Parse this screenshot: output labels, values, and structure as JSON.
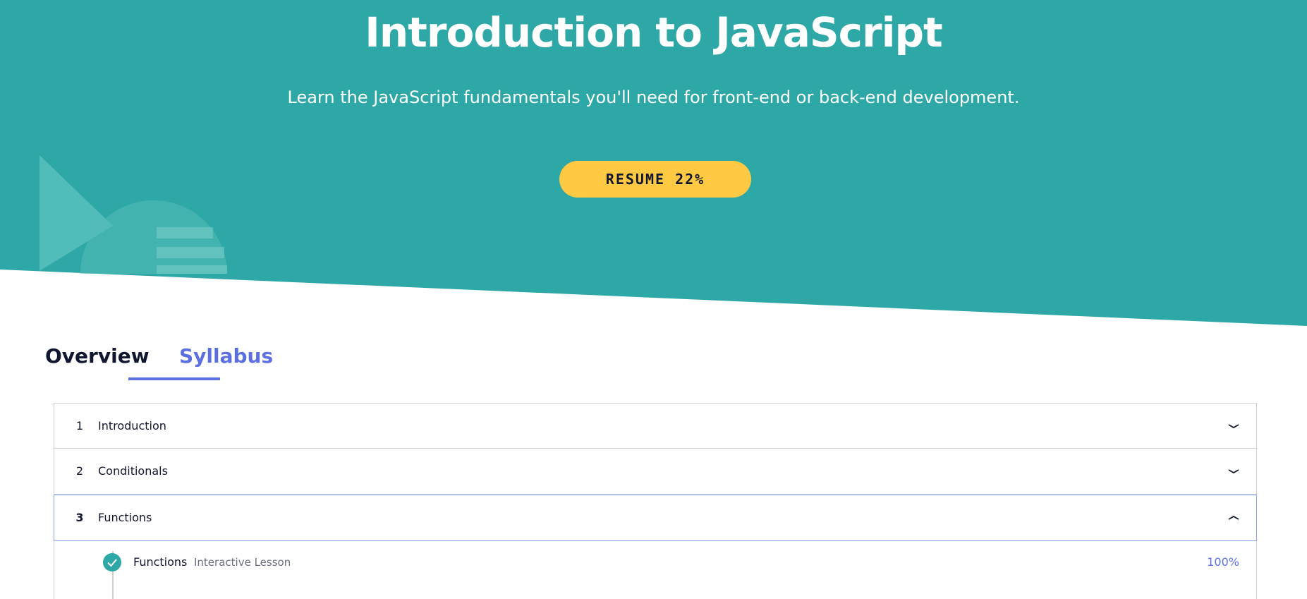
{
  "hero": {
    "title": "Introduction to JavaScript",
    "subtitle": "Learn the JavaScript fundamentals you'll need for front-end or back-end development.",
    "resume_label": "RESUME 22%",
    "background_color": "#2ea8a6",
    "button_color": "#ffc943"
  },
  "tabs": [
    {
      "label": "Overview",
      "active": false
    },
    {
      "label": "Syllabus",
      "active": true
    }
  ],
  "colors": {
    "accent": "#5c6fe0",
    "text_dark": "#10162f",
    "success": "#2ea8a6"
  },
  "syllabus": {
    "modules": [
      {
        "number": "1",
        "title": "Introduction",
        "expanded": false,
        "icon": "chevron-down-icon"
      },
      {
        "number": "2",
        "title": "Conditionals",
        "expanded": false,
        "icon": "chevron-down-icon"
      },
      {
        "number": "3",
        "title": "Functions",
        "expanded": true,
        "icon": "chevron-up-icon"
      }
    ],
    "lessons": [
      {
        "title": "Functions",
        "type": "Interactive Lesson",
        "progress": "100%",
        "completed": true,
        "icon": "check-circle-icon"
      }
    ]
  }
}
